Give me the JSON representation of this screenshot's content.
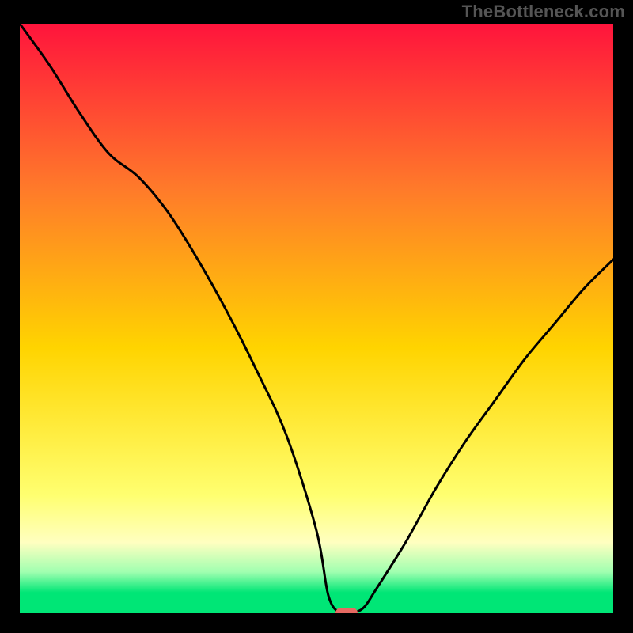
{
  "attribution": "TheBottleneck.com",
  "colors": {
    "top": "#ff143c",
    "mid_upper": "#ff7a2a",
    "mid": "#ffd400",
    "lower_yellow": "#ffff70",
    "band_yellow_pale": "#ffffc0",
    "green_light": "#a0ffb0",
    "green": "#00e676",
    "frame": "#000000",
    "curve": "#000000",
    "marker": "#e66a62"
  },
  "chart_data": {
    "type": "line",
    "title": "",
    "xlabel": "",
    "ylabel": "",
    "xlim": [
      0,
      100
    ],
    "ylim": [
      0,
      100
    ],
    "x": [
      0,
      5,
      10,
      15,
      20,
      25,
      30,
      35,
      40,
      45,
      50,
      52,
      54,
      56,
      58,
      60,
      65,
      70,
      75,
      80,
      85,
      90,
      95,
      100
    ],
    "values": [
      100,
      93,
      85,
      78,
      74,
      68,
      60,
      51,
      41,
      30,
      14,
      3,
      0,
      0,
      1,
      4,
      12,
      21,
      29,
      36,
      43,
      49,
      55,
      60
    ],
    "marker": {
      "x": 55,
      "y": 0
    },
    "gradient_stops": [
      {
        "offset": 0.0,
        "color": "#ff143c"
      },
      {
        "offset": 0.28,
        "color": "#ff7a2a"
      },
      {
        "offset": 0.55,
        "color": "#ffd400"
      },
      {
        "offset": 0.8,
        "color": "#ffff70"
      },
      {
        "offset": 0.88,
        "color": "#ffffc0"
      },
      {
        "offset": 0.93,
        "color": "#a0ffb0"
      },
      {
        "offset": 0.965,
        "color": "#00e676"
      },
      {
        "offset": 1.0,
        "color": "#00e676"
      }
    ]
  }
}
